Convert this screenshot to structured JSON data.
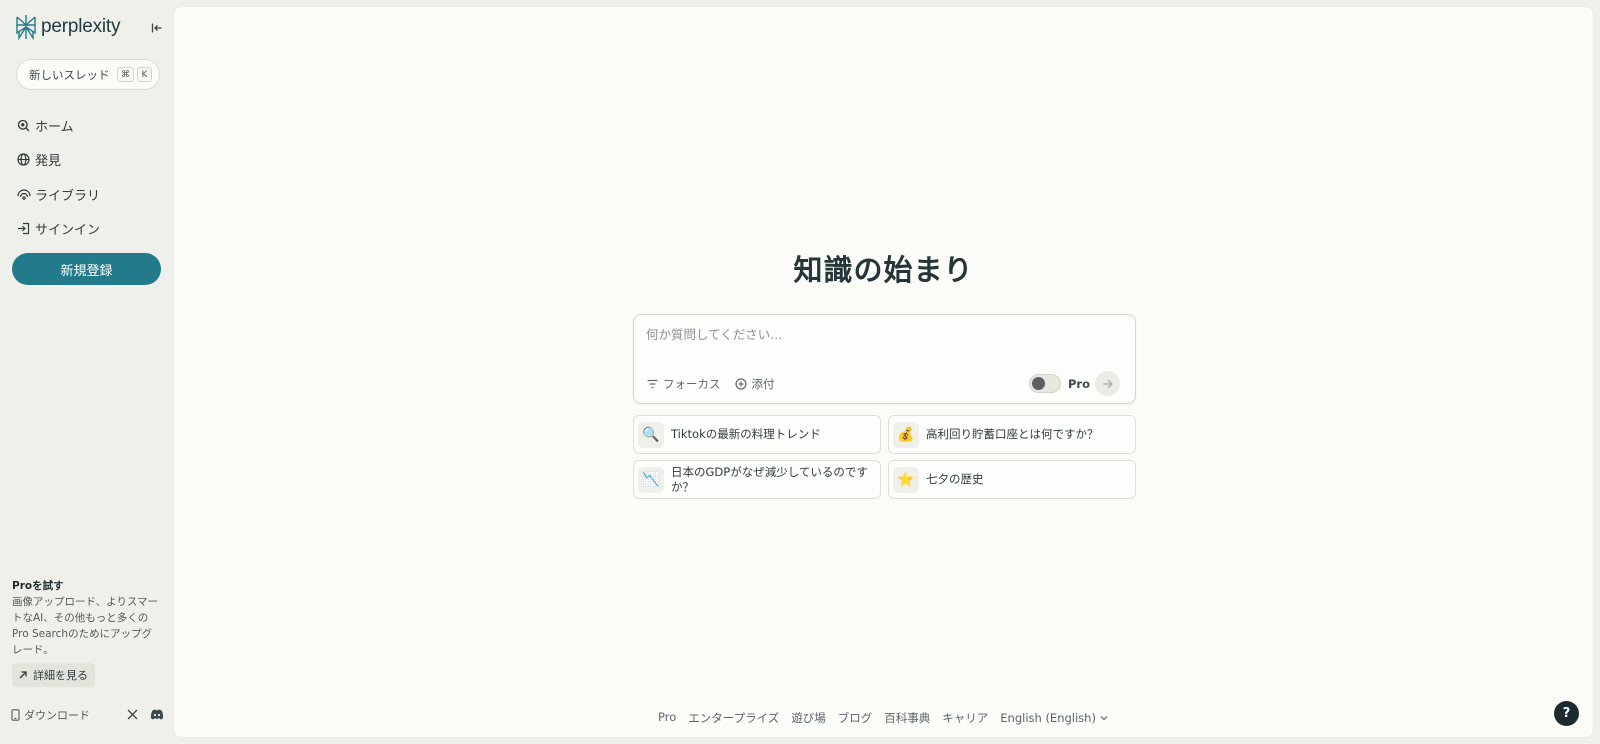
{
  "brand": {
    "name": "perplexity",
    "accent": "#237a8a"
  },
  "sidebar": {
    "new_thread": {
      "label": "新しいスレッド",
      "shortcut": [
        "⌘",
        "K"
      ]
    },
    "items": [
      {
        "label": "ホーム",
        "icon": "search-icon"
      },
      {
        "label": "発見",
        "icon": "globe-icon"
      },
      {
        "label": "ライブラリ",
        "icon": "library-icon"
      },
      {
        "label": "サインイン",
        "icon": "sign-in-icon"
      }
    ],
    "signup_label": "新規登録",
    "promo": {
      "title": "Proを試す",
      "body": "画像アップロード、よりスマートなAI、その他もっと多くのPro Searchのためにアップグレード。",
      "details_label": "詳細を見る"
    },
    "download_label": "ダウンロード"
  },
  "main": {
    "hero": "知識の始まり",
    "search": {
      "placeholder": "何か質問してください...",
      "focus_label": "フォーカス",
      "attach_label": "添付",
      "pro_label": "Pro"
    },
    "suggestions": [
      {
        "emoji": "🔍",
        "text": "Tiktokの最新の料理トレンド"
      },
      {
        "emoji": "💰",
        "text": "高利回り貯蓄口座とは何ですか？"
      },
      {
        "emoji": "📉",
        "text": "日本のGDPがなぜ減少しているのですか？"
      },
      {
        "emoji": "⭐",
        "text": "七夕の歴史"
      }
    ],
    "footer_links": [
      "Pro",
      "エンタープライズ",
      "遊び場",
      "ブログ",
      "百科事典",
      "キャリア"
    ],
    "language": "English (English)",
    "help_label": "?"
  }
}
